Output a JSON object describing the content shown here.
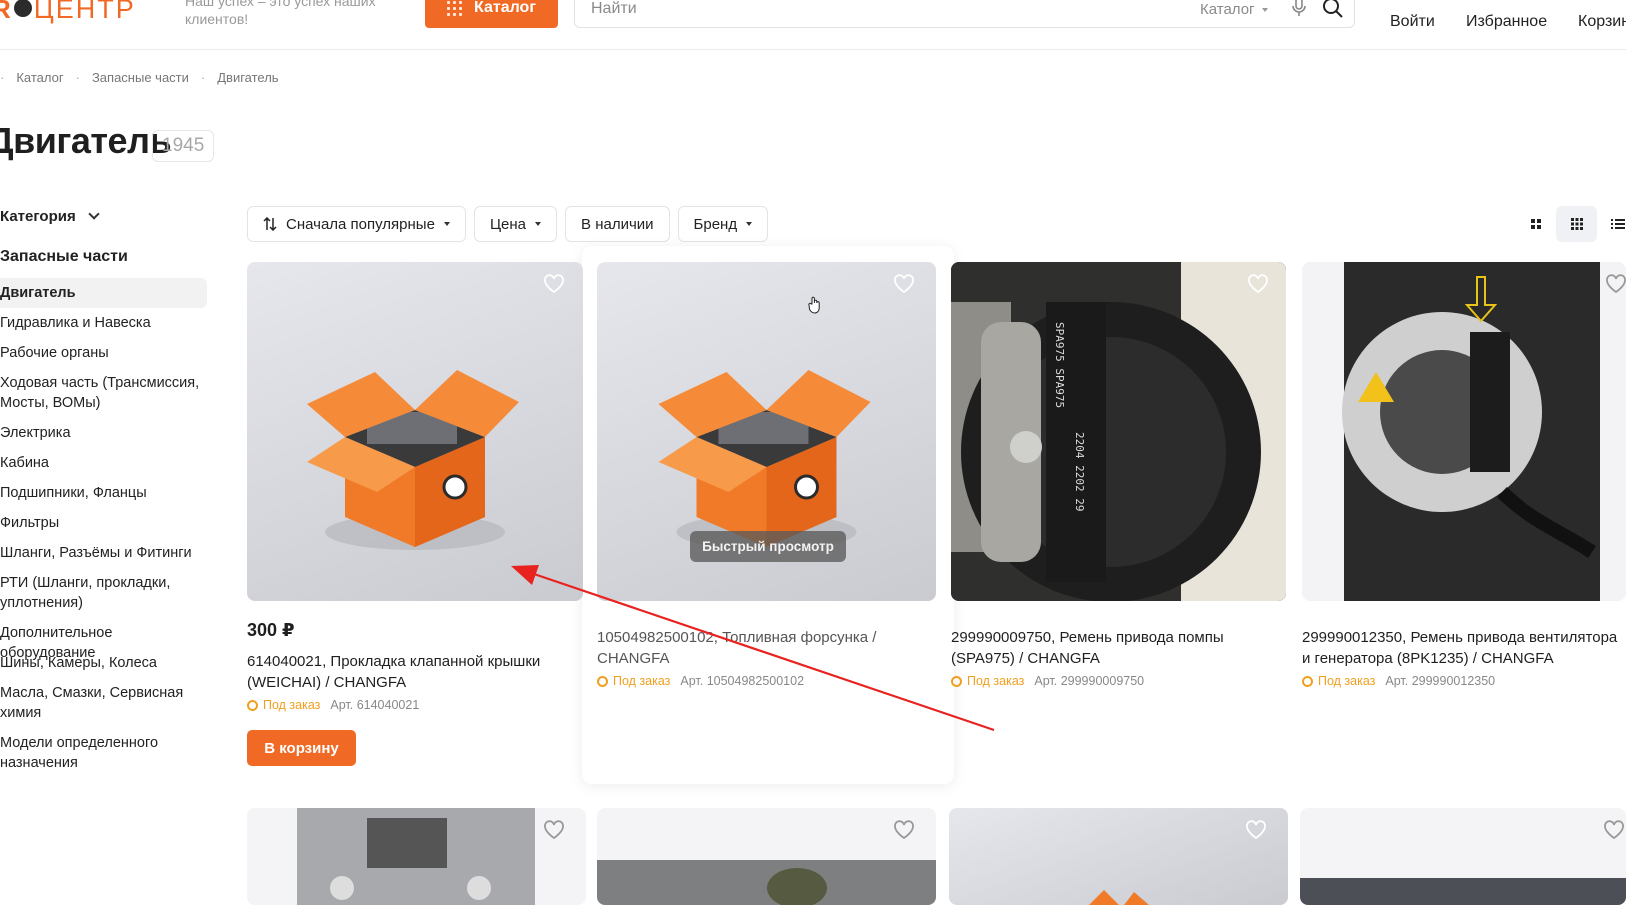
{
  "header": {
    "logo_text_1": "R",
    "logo_text_2": "ЦЕНТР",
    "slogan": "Наш успех – это успех наших клиентов!",
    "catalog_button": "Каталог",
    "search_placeholder": "Найти",
    "search_category": "Каталог",
    "login": "Войти",
    "favorites": "Избранное",
    "cart": "Корзина"
  },
  "breadcrumb": [
    "Каталог",
    "Запасные части",
    "Двигатель"
  ],
  "page": {
    "title": "Двигатель",
    "count": "1945"
  },
  "sidebar": {
    "heading": "Категория",
    "subheading": "Запасные части",
    "items": [
      {
        "label": "Двигатель",
        "active": true
      },
      {
        "label": "Гидравлика и Навеска"
      },
      {
        "label": "Рабочие органы"
      },
      {
        "label": "Ходовая часть (Трансмиссия, Мосты, ВОМы)"
      },
      {
        "label": "Электрика"
      },
      {
        "label": "Кабина"
      },
      {
        "label": "Подшипники, Фланцы"
      },
      {
        "label": "Фильтры"
      },
      {
        "label": "Шланги, Разъёмы и Фитинги"
      },
      {
        "label": "РТИ (Шланги, прокладки, уплотнения)"
      },
      {
        "label": "Дополнительное оборудование"
      },
      {
        "label": "Шины, Камеры, Колеса"
      },
      {
        "label": "Масла, Смазки, Сервисная химия"
      },
      {
        "label": "Модели определенного назначения"
      }
    ]
  },
  "filters": {
    "sort": "Сначала популярные",
    "price": "Цена",
    "in_stock": "В наличии",
    "brand": "Бренд"
  },
  "quick_view": "Быстрый просмотр",
  "products": [
    {
      "price": "300 ₽",
      "title": "614040021, Прокладка клапанной крышки (WEICHAI) / CHANGFA",
      "status": "Под заказ",
      "article": "Арт. 614040021",
      "cart_button": "В корзину"
    },
    {
      "title": "10504982500102, Топливная форсунка / CHANGFA",
      "status": "Под заказ",
      "article": "Арт. 10504982500102"
    },
    {
      "title": "299990009750, Ремень привода помпы (SPA975) / CHANGFA",
      "status": "Под заказ",
      "article": "Арт. 299990009750"
    },
    {
      "title": "299990012350, Ремень привода вентилятора и генератора (8PK1235) / CHANGFA",
      "status": "Под заказ",
      "article": "Арт. 299990012350"
    }
  ],
  "colors": {
    "accent": "#f06a25",
    "order_status": "#f0a020",
    "annotation_arrow": "#e8231f"
  }
}
